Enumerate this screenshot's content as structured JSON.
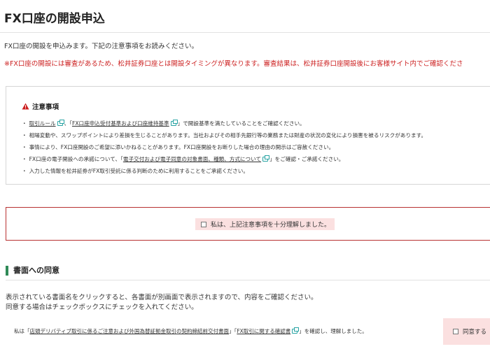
{
  "header": {
    "title": "FX口座の開設申込"
  },
  "intro": {
    "text": "FX口座の開設を申込みます。下記の注意事項をお読みください。",
    "warning": "※FX口座の開設には審査があるため、松井証券口座とは開設タイミングが異なります。審査結果は、松井証券口座開設後にお客様サイト内でご確認くださ"
  },
  "notice": {
    "heading": "注意事項",
    "icon": "warning-triangle-icon",
    "items": {
      "rule_link": "取引ルール",
      "rule_mid": "、「",
      "criteria_link": "FX口座申込受付基準および口座維持基準",
      "rule_tail": "」で開設基準を満たしていることをご確認ください。",
      "item2": "相場変動や、スワップポイントにより差損を生じることがあります。当社およびその相手先銀行等の業務または財産の状況の変化により損害を被るリスクがあります。",
      "item3": "事情により、FX口座開設のご希望に添いかねることがあります。FX口座開設をお断りした場合の理由の開示はご容赦ください。",
      "item4_pre": "FX口座の電子開設への承諾について、「",
      "item4_link": "電子交付および電子同意の対象書面、種類、方式について",
      "item4_tail": "」をご確認・ご承諾ください。",
      "item5": "入力した情報を松井証券がFX取引受託に係る判断のために利用することをご承諾ください。"
    }
  },
  "confirm": {
    "label": "私は、上記注意事項を十分理解しました。"
  },
  "documents": {
    "section_title": "書面への同意",
    "desc1": "表示されている書面名をクリックすると、各書面が別画面で表示されますので、内容をご確認ください。",
    "desc2": "同意する場合はチェックボックスにチェックを入れてください。",
    "line_pre": "私は「",
    "doc1_link": "店頭デリバティブ取引に係るご注意および外国為替証拠金取引の契約締結前交付書面",
    "line_mid": "」「",
    "doc2_link": "FX取引に関する確認書",
    "line_tail": "」を確認し、理解しました。",
    "agree_label": "同意する"
  },
  "colors": {
    "warning_red": "#cc1f1f",
    "confirm_border": "#b83232",
    "confirm_bg": "#fbe0e0",
    "section_accent": "#2f8a57",
    "link_icon": "#27a3a3"
  }
}
